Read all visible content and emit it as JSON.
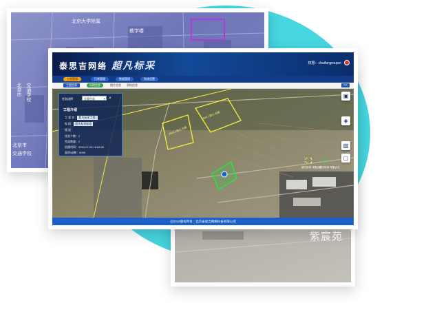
{
  "header": {
    "logo_main": "泰思吉网络",
    "logo_brand": "超凡标采",
    "user_label": "权限：chaifangrouper"
  },
  "nav": {
    "items": [
      {
        "label": "工程管理",
        "active": true
      },
      {
        "label": "日常管理",
        "active": false
      },
      {
        "label": "数据管理",
        "active": false
      },
      {
        "label": "系统设置",
        "active": false
      }
    ]
  },
  "tabs": {
    "items": [
      "工程信息",
      "拆除信息",
      "图片信息",
      "测绘信息"
    ],
    "collapse": "<<"
  },
  "panel": {
    "filter_label": "任务选择",
    "filter_value": "全面任务",
    "title": "工程介绍",
    "rows": [
      {
        "label": "工 程 名：",
        "value": "超凡标采工程1"
      },
      {
        "label": "标    段：",
        "value": "超凡标采标段"
      },
      {
        "label": "描    述：",
        "value": ""
      },
      {
        "label": "任务个数：",
        "value": "2"
      },
      {
        "label": "完成数量：",
        "value": "2"
      },
      {
        "label": "创建时间：",
        "value": "2019-07-05 16:08:06"
      },
      {
        "label": "面积/亩数：",
        "value": "5055"
      }
    ]
  },
  "map": {
    "parcel_labels": [
      "2566.1亩(1.9)亩",
      "2566.1亩(1.9)亩"
    ],
    "legend": [
      {
        "label": "超凡标采\n采集点位",
        "color": "#e8e84a"
      },
      {
        "label": "超凡标采\n采集点位",
        "color": "#2ecc40"
      }
    ],
    "tools": [
      "layers-icon",
      "stack-icon",
      "image-icon",
      "fullscreen-icon"
    ]
  },
  "footer": {
    "text": "@2019版权所有：北京泰思吉网络科技有限公司"
  },
  "background": {
    "left_labels": [
      "北京大学附属",
      "教学楼",
      "北京市",
      "交通学校",
      "北京市",
      "交通学校"
    ],
    "right_watermark": "紫宸苑"
  }
}
